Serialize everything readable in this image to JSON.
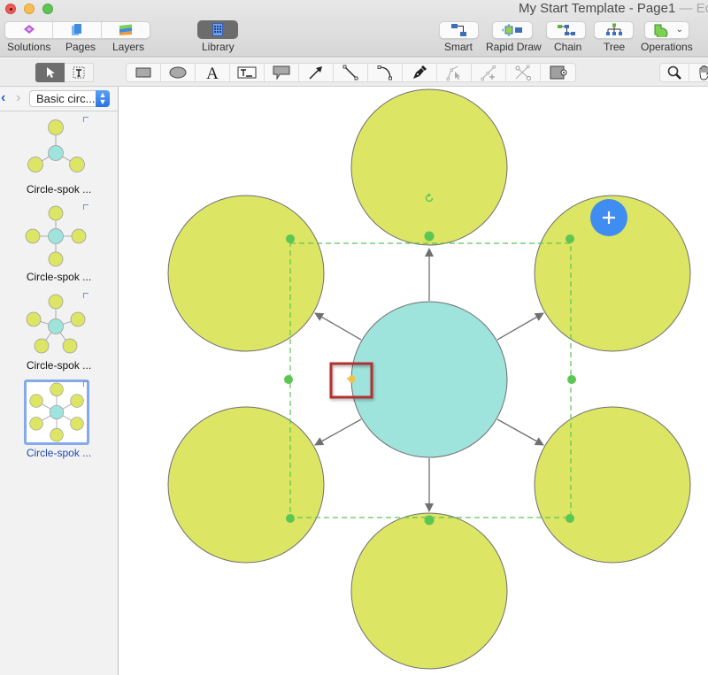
{
  "window": {
    "title": "My Start Template - Page1",
    "title_suffix": " — Edi"
  },
  "toolbar": {
    "solutions_label": "Solutions",
    "pages_label": "Pages",
    "layers_label": "Layers",
    "library_label": "Library",
    "smart_label": "Smart",
    "rapid_draw_label": "Rapid Draw",
    "chain_label": "Chain",
    "tree_label": "Tree",
    "operations_label": "Operations"
  },
  "tools": {
    "select": "select-arrow",
    "text_select": "text-select",
    "drawing": [
      "rectangle",
      "ellipse",
      "text",
      "text-box",
      "callout",
      "arrow-line",
      "line",
      "arc",
      "pen",
      "direct-select",
      "add-point",
      "cut-path",
      "container"
    ],
    "view": [
      "zoom",
      "hand"
    ]
  },
  "sidebar": {
    "library_select": "Basic circ...",
    "items": [
      {
        "label": "Circle-spok ...",
        "spokes": 3,
        "selected": false
      },
      {
        "label": "Circle-spok ...",
        "spokes": 4,
        "selected": false
      },
      {
        "label": "Circle-spok ...",
        "spokes": 5,
        "selected": false
      },
      {
        "label": "Circle-spok ...",
        "spokes": 6,
        "selected": true
      }
    ]
  },
  "diagram": {
    "center_color": "#9ee3dc",
    "spoke_color": "#dce564",
    "spokes": 6,
    "selection_color": "#5cc653",
    "highlight_color": "#b23232",
    "add_button_color": "#3f8df0",
    "connection_point_color": "#f5c242"
  }
}
